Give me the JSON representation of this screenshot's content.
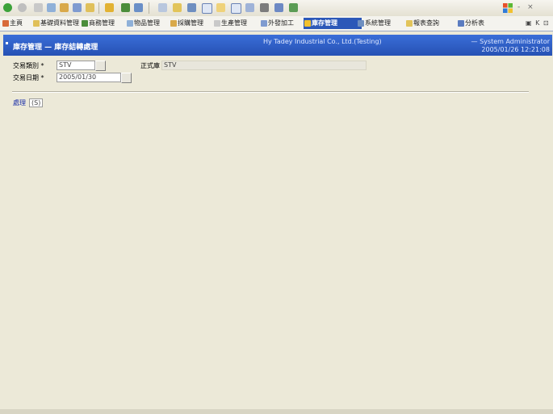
{
  "toolbar": {
    "icons": [
      "back-icon",
      "forward-icon",
      "stop-icon",
      "refresh-icon",
      "home-icon",
      "search-icon",
      "favorites-icon",
      "history-icon",
      "mail-icon",
      "print-icon",
      "edit-icon",
      "folder-icon",
      "messenger-icon",
      "window-icon",
      "window-icon-2",
      "grid-icon",
      "globe-icon",
      "user-icon",
      "save-icon",
      "help-icon"
    ],
    "window_controls": "-  ×"
  },
  "tabs": [
    {
      "label": "主頁"
    },
    {
      "label": "基礎資料管理"
    },
    {
      "label": "商務管理"
    },
    {
      "label": "物品管理"
    },
    {
      "label": "採購管理"
    },
    {
      "label": "生產管理"
    },
    {
      "label": "外發加工"
    },
    {
      "label": "庫存管理"
    },
    {
      "label": "系統管理"
    },
    {
      "label": "報表查詢"
    },
    {
      "label": "分析表"
    }
  ],
  "tab_tail": "▣ K ⊡",
  "header": {
    "title": "庫存管理 — 庫存結轉處理",
    "company": "Hy Tadey Industrial Co., Ltd.(Testing)",
    "user": "— System Administrator",
    "date": "2005/01/26 12:21:08"
  },
  "form": {
    "transaction_type_label": "交易類別 *",
    "transaction_type_value": "STV",
    "remark_label": "正式庫",
    "remark_value": "STV",
    "transaction_date_label": "交易日期 *",
    "transaction_date_value": "2005/01/30"
  },
  "actions": {
    "process_label": "處理",
    "shortcut_label": "(S)"
  },
  "colors": {
    "window_bg": "#ece9d8",
    "header_blue": "#2651b4",
    "active_tab": "#2c58b8"
  }
}
